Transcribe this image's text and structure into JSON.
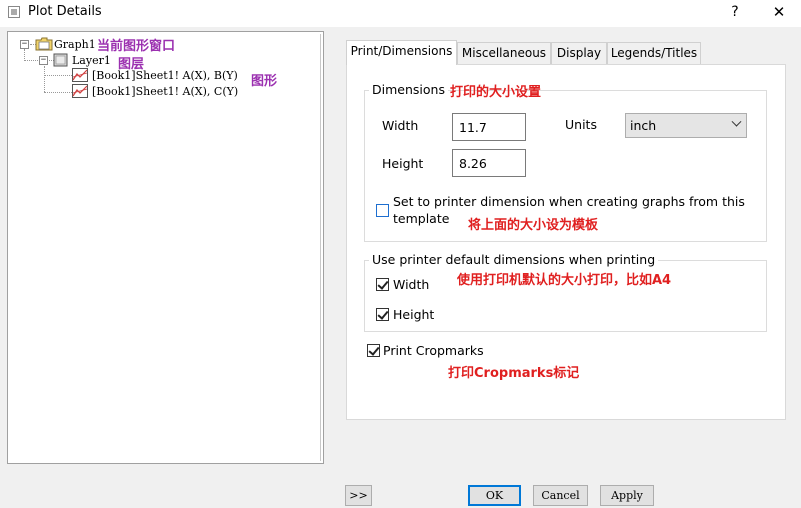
{
  "window": {
    "title": "Plot Details",
    "help_label": "?",
    "close_label": "✕"
  },
  "tree": {
    "graph_label": "Graph1",
    "layer_label": "Layer1",
    "plots": [
      "[Book1]Sheet1! A(X), B(Y)",
      "[Book1]Sheet1! A(X), C(Y)"
    ],
    "expand_symbol": "−",
    "notes": {
      "graph": "当前图形窗口",
      "layer": "图层",
      "plot": "图形"
    }
  },
  "tabs": [
    "Print/Dimensions",
    "Miscellaneous",
    "Display",
    "Legends/Titles"
  ],
  "dimensions": {
    "legend": "Dimensions",
    "note": "打印的大小设置",
    "width_label": "Width",
    "width_value": "11.7",
    "height_label": "Height",
    "height_value": "8.26",
    "units_label": "Units",
    "units_value": "inch",
    "set_printer_label_line1": "Set to printer dimension when creating graphs from this",
    "set_printer_label_line2": "template",
    "set_printer_checked": false,
    "set_printer_note": "将上面的大小设为模板"
  },
  "printer_defaults": {
    "legend": "Use printer default dimensions when printing",
    "note": "使用打印机默认的大小打印，比如A4",
    "width_label": "Width",
    "width_checked": true,
    "height_label": "Height",
    "height_checked": true
  },
  "cropmarks": {
    "label": "Print Cropmarks",
    "checked": true,
    "note": "打印Cropmarks标记"
  },
  "buttons": {
    "expand": ">>",
    "ok": "OK",
    "cancel": "Cancel",
    "apply": "Apply"
  }
}
